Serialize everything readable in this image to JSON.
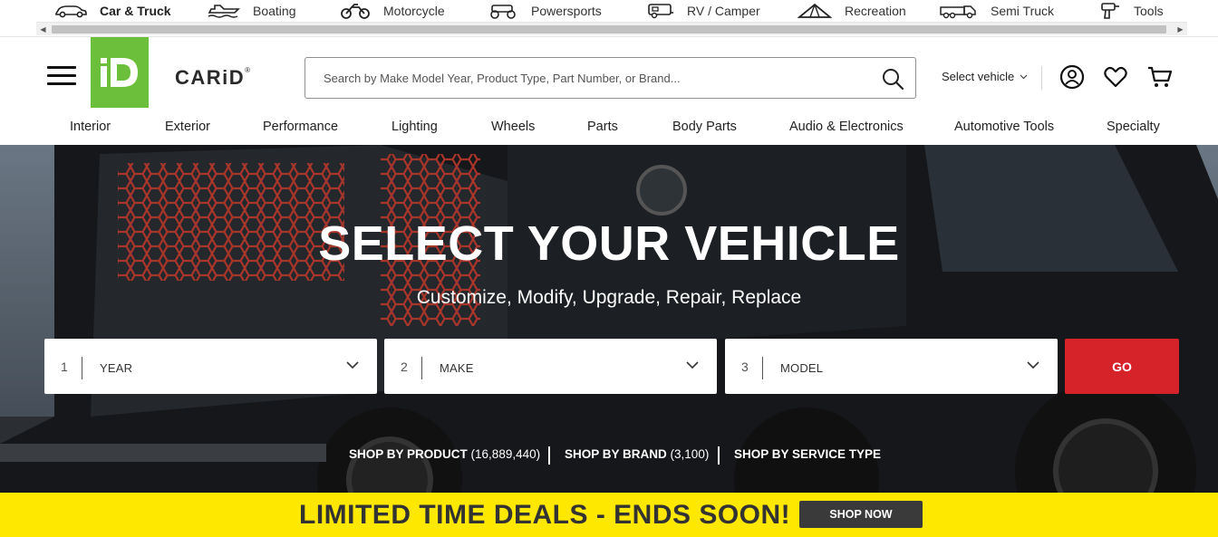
{
  "categories": [
    {
      "label": "Car & Truck",
      "icon": "car-icon",
      "active": true
    },
    {
      "label": "Boating",
      "icon": "boat-icon",
      "active": false
    },
    {
      "label": "Motorcycle",
      "icon": "motorcycle-icon",
      "active": false
    },
    {
      "label": "Powersports",
      "icon": "atv-icon",
      "active": false
    },
    {
      "label": "RV / Camper",
      "icon": "rv-icon",
      "active": false
    },
    {
      "label": "Recreation",
      "icon": "tent-icon",
      "active": false
    },
    {
      "label": "Semi Truck",
      "icon": "semi-truck-icon",
      "active": false
    },
    {
      "label": "Tools",
      "icon": "drill-icon",
      "active": false
    }
  ],
  "header": {
    "logo_mark": "iD",
    "logo_text": "CARiD",
    "logo_reg": "®",
    "search_placeholder": "Search by Make Model Year, Product Type, Part Number, or Brand...",
    "select_vehicle_label": "Select vehicle",
    "brand_color": "#6bbf3a"
  },
  "nav": [
    "Interior",
    "Exterior",
    "Performance",
    "Lighting",
    "Wheels",
    "Parts",
    "Body Parts",
    "Audio & Electronics",
    "Automotive Tools",
    "Specialty"
  ],
  "hero": {
    "title": "SELECT YOUR VEHICLE",
    "subtitle": "Customize, Modify, Upgrade, Repair, Replace",
    "selectors": [
      {
        "num": "1",
        "label": "YEAR"
      },
      {
        "num": "2",
        "label": "MAKE"
      },
      {
        "num": "3",
        "label": "MODEL"
      }
    ],
    "go_label": "GO",
    "go_color": "#d6232a",
    "shop_links": [
      {
        "label": "SHOP BY PRODUCT",
        "count": "(16,889,440)"
      },
      {
        "label": "SHOP BY BRAND",
        "count": "(3,100)"
      },
      {
        "label": "SHOP BY SERVICE TYPE",
        "count": ""
      }
    ]
  },
  "promo": {
    "text": "LIMITED TIME DEALS - ENDS SOON!",
    "button_label": "SHOP NOW",
    "background": "#ffe800"
  }
}
